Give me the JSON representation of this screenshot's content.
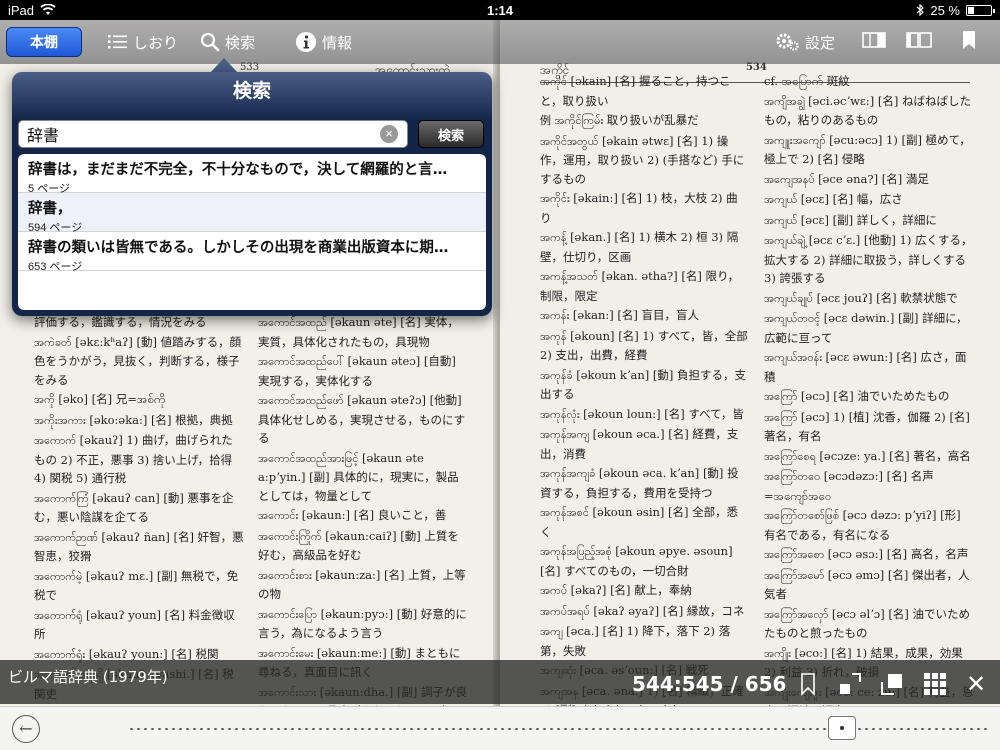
{
  "status": {
    "device": "iPad",
    "time": "1:14",
    "battery": "25 %"
  },
  "toolbar": {
    "home_label": "本棚",
    "bookmarks_label": "しおり",
    "search_label": "検索",
    "info_label": "情報",
    "settings_label": "設定"
  },
  "search_popover": {
    "title": "検索",
    "query": "辞書",
    "submit_label": "検索",
    "clear_glyph": "×",
    "results": [
      {
        "text": "辞書は，まだまだ不完全，不十分なもので，決して網羅的と言…",
        "page": "5 ページ"
      },
      {
        "text": "辞書，",
        "page": "594 ページ"
      },
      {
        "text": "辞書の類いは皆無である。しかしその出現を商業出版資本に期…",
        "page": "653 ページ"
      }
    ]
  },
  "left_page": {
    "page_number": "533",
    "header": "အကောင်းသားတဲ",
    "col1": [
      {
        "hw": "",
        "text": "評価する，鑑識する，情況をみる"
      },
      {
        "hw": "အကဲခတ်",
        "text": "[əkɛ:kʰaʔ] [動] 値踏みする，顔色をうかがう，見抜く，判断する，様子をみる"
      },
      {
        "hw": "အကို",
        "text": "[əko] [名] 兄=အစ်ကို"
      },
      {
        "hw": "အကိုးအကား",
        "text": "[əko:əka:] [名] 根拠，典拠"
      },
      {
        "hw": "အကောက်",
        "text": "[əkauʔ] 1) 曲げ，曲げられたもの 2) 不正，悪事 3) 捨い上げ，拾得 4) 関税 5) 通行税"
      },
      {
        "hw": "အကောက်ကြံ",
        "text": "[əkauʔ can] [動] 悪事を企む，悪い陰謀を企てる"
      },
      {
        "hw": "အကောက်ဉာဏ်",
        "text": "[əkauʔ ñan] [名] 奸智，悪智恵，狡猾"
      },
      {
        "hw": "အကောက်မဲ့",
        "text": "[əkauʔ mɛ.] [副] 無税で，免税で"
      },
      {
        "hw": "အကောက်ရုံ",
        "text": "[əkauʔ youn] [名] 料金徴収所"
      },
      {
        "hw": "အကောက်ရုံး",
        "text": "[əkauʔ youn:] [名] 税関"
      },
      {
        "hw": "အကောက်အရာရှိ",
        "text": "[əkauʔ əyashi.] [名] 税関吏"
      },
      {
        "hw": "အကိုက်",
        "text": "[əkaiʔ] 1) 痛み，疼痛 2) 刺"
      }
    ],
    "col2": [
      {
        "hw": "အကောင်အထည်",
        "text": "[əkaun əte] [名] 実体，実質，具体化されたもの，具現物"
      },
      {
        "hw": "အကောင်အထည်ပေါ်",
        "text": "[əkaun əteɔ] [自動] 実現する，実体化する"
      },
      {
        "hw": "အကောင်အထည်ဖော်",
        "text": "[əkaun əteʔɔ] [他動] 具体化せしめる，実現させる，ものにする"
      },
      {
        "hw": "အကောင်အထည်အားဖြင့်",
        "text": "[əkaun əte a:pʼyin.] [副] 具体的に，現実に，製品としては，物量として"
      },
      {
        "hw": "အကောင်း",
        "text": "[əkaun:] [名] 良いこと，善"
      },
      {
        "hw": "အကောင်းကြိုက်",
        "text": "[əkaun:caiʔ] [動] 上質を好む，高級品を好む"
      },
      {
        "hw": "အကောင်းစား",
        "text": "[əkaun:za:] [名] 上質，上等の物"
      },
      {
        "hw": "အကောင်းပြော",
        "text": "[əkaun:pyɔ:] [動] 好意的に言う，為になるよう言う"
      },
      {
        "hw": "အကောင်းမေး",
        "text": "[əkaun:me:] [動] まともに尋ねる，真面目に訊く"
      },
      {
        "hw": "အကောင်းသား",
        "text": "[əkaun:dha.] [副] 調子が良かったのに，具合がよかったのに，何ともなかったのに"
      },
      {
        "hw": "အကောင်းသားတဲ",
        "text": "[əkaun:dha:be:] 結構です，承知した，なかなかよいではないか"
      }
    ]
  },
  "right_page": {
    "page_number": "534",
    "header": "အကိုင်",
    "col1": [
      {
        "hw": "အကိုင်",
        "text": "[əkain] [名] 握ること，持つこと，取り扱い"
      },
      {
        "hw": "例 အကိုင်ကြမ်း",
        "text": "取り扱いが乱暴だ"
      },
      {
        "hw": "အကိုင်အတွယ်",
        "text": "[əkain ətwɛ] [名] 1) 操作，運用，取り扱い 2) (手搭など) 手にするもの"
      },
      {
        "hw": "အကိုင်း",
        "text": "[əkain:] [名] 1) 枝，大枝 2) 曲り"
      },
      {
        "hw": "အကန့်",
        "text": "[əkan.] [名] 1) 横木 2) 桓 3) 隔壁，仕切り，区画"
      },
      {
        "hw": "အကန့်အသတ်",
        "text": "[əkan. ətha?] [名] 限り，制限，限定"
      },
      {
        "hw": "အကန်း",
        "text": "[əkan:] [名] 盲目，盲人"
      },
      {
        "hw": "အကုန်",
        "text": "[əkoun] [名] 1) すべて，皆，全部 2) 支出，出費，経費"
      },
      {
        "hw": "အကုန်ခံ",
        "text": "[əkoun kʼan] [動] 負担する，支出する"
      },
      {
        "hw": "အကုန်လုံး",
        "text": "[əkoun loun:] [名] すべて，皆"
      },
      {
        "hw": "အကုန်အကျ",
        "text": "[əkoun əca.] [名] 経費，支出，消費"
      },
      {
        "hw": "အကုန်အကျခံ",
        "text": "[əkoun əca. kʼan] [動] 投資する，負担する，費用を受持つ"
      },
      {
        "hw": "အကုန်အစင်",
        "text": "[əkoun əsin] [名] 全部，悉く"
      },
      {
        "hw": "အကုန်အပြည့်အစုံ",
        "text": "[əkoun əpye. əsoun] [名] すべてのもの，一切合財"
      },
      {
        "hw": "အကပ်",
        "text": "[əkaʔ] [名] 献上，奉納"
      },
      {
        "hw": "အကပ်အရပ်",
        "text": "[əkaʔ əyaʔ] [名] 縁故，コネ"
      },
      {
        "hw": "အကျ",
        "text": "[əca.] [名] 1) 降下，落下 2) 落第，失敗"
      },
      {
        "hw": "အကျဆုံး",
        "text": "[əca. əsʼoun:] [名] 戦死"
      },
      {
        "hw": "အကျအန",
        "text": "[əca. əna.] 1) [名] 精緻，正確 2) [副] きちんと，ちゃんと"
      },
      {
        "hw": "အကျအရှုံး",
        "text": "[əca. əshoun:] [名] 落第，失敗，損失"
      },
      {
        "hw": "အကျား",
        "text": "[əca:] [名] 縞"
      }
    ],
    "col2": [
      {
        "hw": "",
        "text": "cf. အပြောက် 斑紋"
      },
      {
        "hw": "အကျိအချွဲ",
        "text": "[əci.əcʼwɛ:] [名] ねばねばしたもの，粘りのあるもの"
      },
      {
        "hw": "အကျူးအကျော်",
        "text": "[əcu:əcɔ] 1) [副] 極めて，極上で 2) [名] 侵略"
      },
      {
        "hw": "အကျေအနပ်",
        "text": "[əce əna?] [名] 満足"
      },
      {
        "hw": "အကျယ်",
        "text": "[əcɛ] [名] 幅，広さ"
      },
      {
        "hw": "အကျယ်",
        "text": "[əcɛ] [副] 詳しく，詳細に"
      },
      {
        "hw": "အကျယ်ချဲ့",
        "text": "[əcɛ cʼɛ.] [他動] 1) 広くする，拡大する 2) 詳細に取扱う，詳しくする 3) 誇張する"
      },
      {
        "hw": "အကျယ်ချုပ်",
        "text": "[əcɛ jouʔ] [名] 軟禁状態で"
      },
      {
        "hw": "အကျယ်တဝင့်",
        "text": "[əcɛ dəwin.] [副] 詳細に，広範に亘って"
      },
      {
        "hw": "အကျယ်အဝန်း",
        "text": "[əcɛ əwun:] [名] 広さ，面積"
      },
      {
        "hw": "အကြော်",
        "text": "[əcɔ] [名] 油でいためたもの"
      },
      {
        "hw": "အကြော်",
        "text": "[əcɔ] 1) [植] 沈香，伽羅 2) [名] 著名，有名"
      },
      {
        "hw": "အကြော်စေရ",
        "text": "[əcɔze: ya.] [名] 著名，高名"
      },
      {
        "hw": "အကြော်တဝေ",
        "text": "[əcɔdəzɔ:] [名] 名声 =အကျော်အဝေ"
      },
      {
        "hw": "အကြော်တစော်ဖြစ်",
        "text": "[əcɔ dəzɔ: pʼyiʔ] [形] 有名である，有名になる"
      },
      {
        "hw": "အကြော်အစော",
        "text": "[əcɔ əsɔ:] [名] 高名，名声"
      },
      {
        "hw": "အကြော်အမော်",
        "text": "[əcɔ əmɔ] [名] 傑出者，人気者"
      },
      {
        "hw": "အကြော်အလှော်",
        "text": "[əcɔ əlʼɔ] [名] 油でいためたものと煎ったもの"
      },
      {
        "hw": "အကျိုး",
        "text": "[əco:] [名] 1) 結果，成果，効果 2) 利益 3) 折れ，破損"
      },
      {
        "hw": "အကျိုးကျေးဇူး",
        "text": "[əco: ce: zu:] [名] 利益，恩恵，福祉，福音"
      },
      {
        "hw": "အကျိုးကျေးဇူးပေး",
        "text": "[əco:cezu: kʼanza:]"
      }
    ]
  },
  "bottom": {
    "book_title": "ビルマ語辞典 (1979年)",
    "page_counter": "544:545 / 656",
    "close_glyph": "✕",
    "back_glyph": "←",
    "reading_progress": 0.83
  }
}
